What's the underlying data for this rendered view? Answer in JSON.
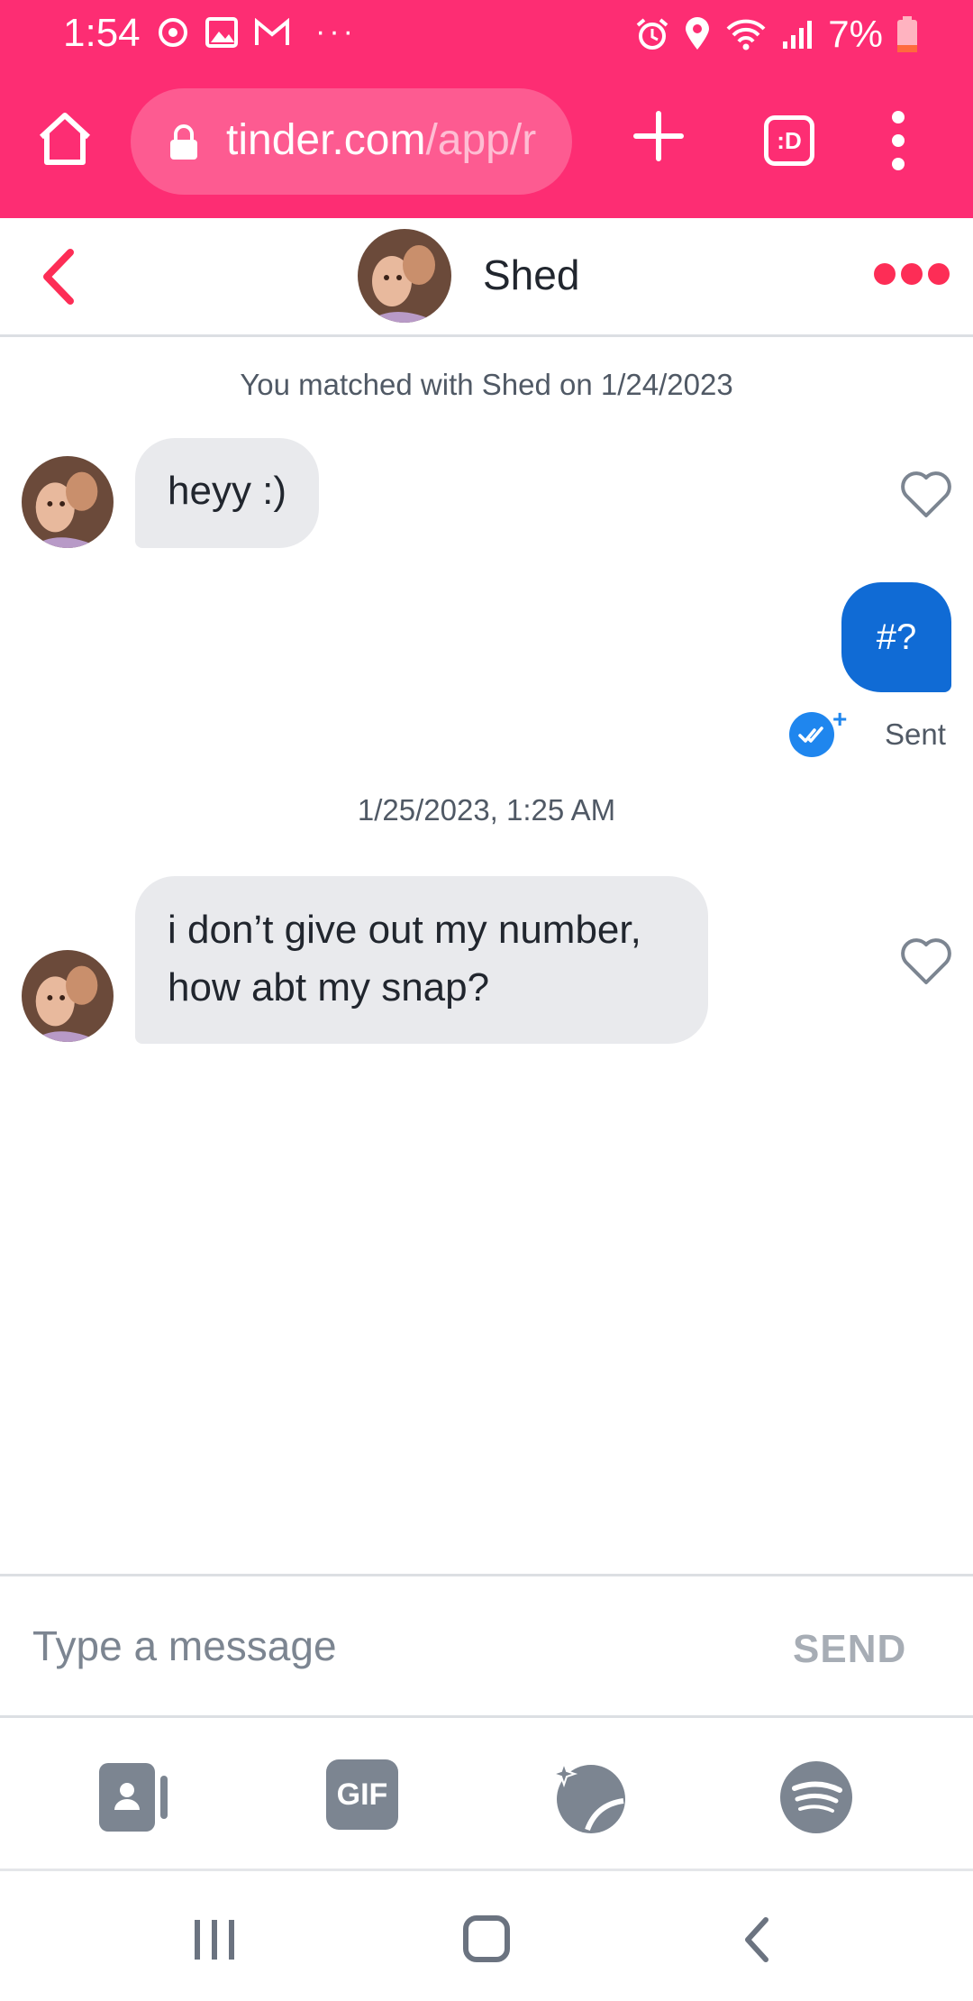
{
  "status_bar": {
    "time": "1:54",
    "battery": "7%"
  },
  "browser": {
    "url_host": "tinder.com",
    "url_path": "/app/r",
    "tabs_label": ":D"
  },
  "chat_header": {
    "name": "Shed"
  },
  "conversation": {
    "match_note": "You matched with Shed on 1/24/2023",
    "messages": [
      {
        "text": "heyy :)"
      },
      {
        "text": "#?"
      },
      {
        "text": "i don’t give out my number, how abt my snap?"
      }
    ],
    "sent_label": "Sent",
    "timestamp": "1/25/2023, 1:25 AM"
  },
  "composer": {
    "placeholder": "Type a message",
    "send_label": "SEND"
  },
  "toolbar": {
    "gif_label": "GIF"
  },
  "colors": {
    "brand": "#fd2d73",
    "accent": "#fd2d56",
    "outgoing_bubble": "#106bd5",
    "incoming_bubble": "#e9eaed"
  },
  "icons": [
    "home-icon",
    "lock-icon",
    "plus-icon",
    "tabs-icon",
    "menu-icon",
    "back-icon",
    "more-icon",
    "heart-icon",
    "double-check-icon",
    "contact-card-icon",
    "gif-icon",
    "sticker-icon",
    "spotify-icon"
  ]
}
